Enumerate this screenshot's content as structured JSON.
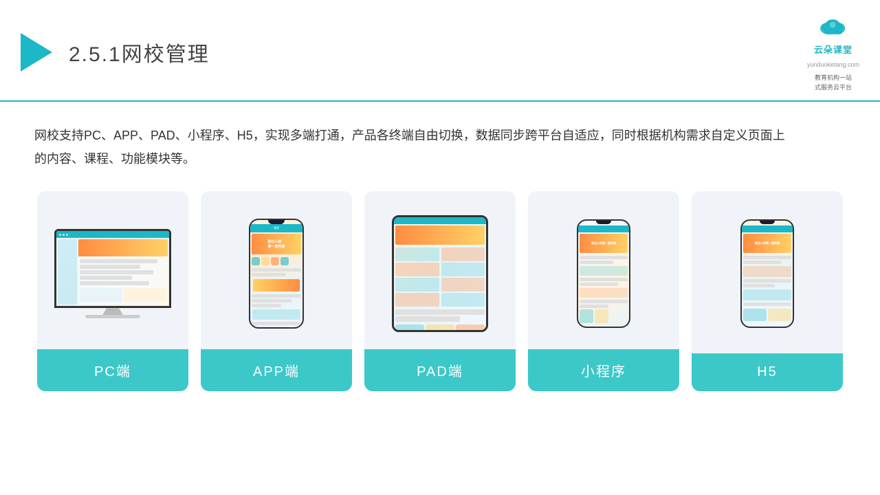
{
  "header": {
    "title_prefix": "2.5.1",
    "title_main": "网校管理",
    "brand_name": "云朵课堂",
    "brand_url": "yunduoketang.com",
    "brand_tagline": "教育机构一站\n式服务云平台"
  },
  "description": "网校支持PC、APP、PAD、小程序、H5，实现多端打通，产品各终端自由切换，数据同步跨平台自适应，同时根据机构需求自定义页面上的内容、课程、功能模块等。",
  "cards": [
    {
      "id": "pc",
      "label": "PC端"
    },
    {
      "id": "app",
      "label": "APP端"
    },
    {
      "id": "pad",
      "label": "PAD端"
    },
    {
      "id": "mini",
      "label": "小程序"
    },
    {
      "id": "h5",
      "label": "H5"
    }
  ],
  "accent_color": "#3cc8c8",
  "header_line_color": "#1cb8c7"
}
